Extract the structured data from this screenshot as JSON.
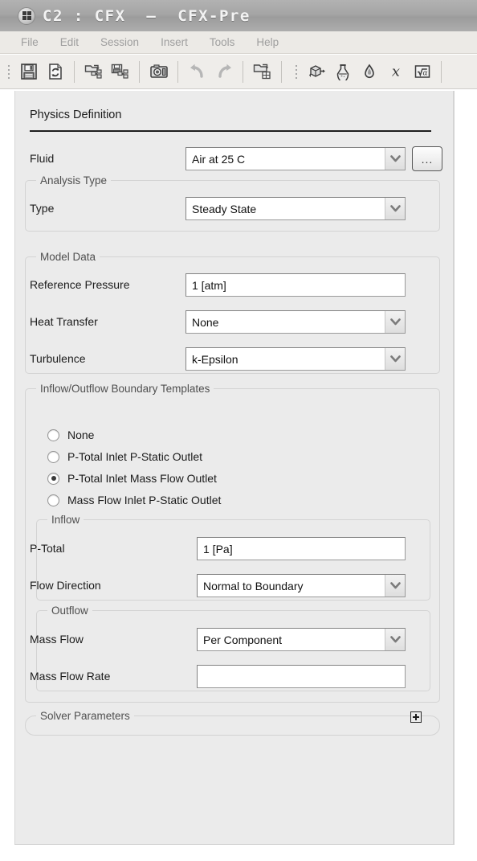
{
  "window": {
    "title": "C2 : CFX  –  CFX-Pre",
    "icon": "app-window-icon"
  },
  "menu": {
    "items": [
      {
        "label": "File"
      },
      {
        "label": "Edit"
      },
      {
        "label": "Session"
      },
      {
        "label": "Insert"
      },
      {
        "label": "Tools"
      },
      {
        "label": "Help"
      }
    ]
  },
  "toolbar": {
    "groups": [
      {
        "buttons": [
          {
            "icon": "save-icon",
            "label": "Save"
          },
          {
            "icon": "refresh-document-icon",
            "label": "Reload"
          }
        ]
      },
      {
        "buttons": [
          {
            "icon": "open-flowchart-icon",
            "label": "Open Case"
          },
          {
            "icon": "save-flowchart-icon",
            "label": "Save Case"
          }
        ]
      },
      {
        "buttons": [
          {
            "icon": "camera-icon",
            "label": "Snapshot"
          }
        ]
      },
      {
        "buttons": [
          {
            "icon": "undo-icon",
            "label": "Undo"
          },
          {
            "icon": "redo-icon",
            "label": "Redo"
          }
        ]
      },
      {
        "buttons": [
          {
            "icon": "export-mesh-icon",
            "label": "Write Solver File"
          }
        ]
      },
      {
        "buttons": [
          {
            "icon": "domain-icon",
            "label": "Domain"
          },
          {
            "icon": "flask-material-icon",
            "label": "Material"
          },
          {
            "icon": "droplet-icon",
            "label": "Fluid"
          },
          {
            "icon": "chi-expression-icon",
            "label": "Expression"
          },
          {
            "icon": "sqrt-variable-icon",
            "label": "Variable"
          }
        ]
      }
    ]
  },
  "panel": {
    "title": "Physics Definition",
    "fluid": {
      "label": "Fluid",
      "value": "Air at 25 C",
      "browse_label": "...",
      "dropdown_icon": "chevron-down-icon"
    },
    "analysis_type": {
      "title": "Analysis Type",
      "type": {
        "label": "Type",
        "value": "Steady State",
        "dropdown_icon": "chevron-down-icon"
      }
    },
    "model_data": {
      "title": "Model Data",
      "reference_pressure": {
        "label": "Reference Pressure",
        "value": "1 [atm]"
      },
      "heat_transfer": {
        "label": "Heat Transfer",
        "value": "None",
        "dropdown_icon": "chevron-down-icon"
      },
      "turbulence": {
        "label": "Turbulence",
        "value": "k-Epsilon",
        "dropdown_icon": "chevron-down-icon"
      }
    },
    "boundary_templates": {
      "title": "Inflow/Outflow Boundary Templates",
      "options": [
        {
          "label": "None",
          "selected": false
        },
        {
          "label": "P-Total Inlet  P-Static Outlet",
          "selected": false
        },
        {
          "label": "P-Total Inlet  Mass Flow Outlet",
          "selected": true
        },
        {
          "label": "Mass Flow Inlet  P-Static Outlet",
          "selected": false
        }
      ],
      "inflow": {
        "title": "Inflow",
        "p_total": {
          "label": "P-Total",
          "value": "1 [Pa]"
        },
        "flow_direction": {
          "label": "Flow Direction",
          "value": "Normal to Boundary",
          "dropdown_icon": "chevron-down-icon"
        }
      },
      "outflow": {
        "title": "Outflow",
        "mass_flow": {
          "label": "Mass Flow",
          "value": "Per Component",
          "dropdown_icon": "chevron-down-icon"
        },
        "mass_flow_rate": {
          "label": "Mass Flow Rate",
          "value": ""
        }
      }
    },
    "solver_parameters": {
      "title": "Solver Parameters",
      "expand_icon": "plus-box-icon",
      "expanded": false
    }
  },
  "colors": {
    "panel_bg": "#ebebeb",
    "titlebar": "#a5a5a5",
    "menubar": "#eceae6",
    "toolbar": "#efedea",
    "field_bg": "#ffffff",
    "text": "#1b1b1b",
    "group_title": "#4f4f4f",
    "menu_disabled": "#9e9e9e"
  }
}
